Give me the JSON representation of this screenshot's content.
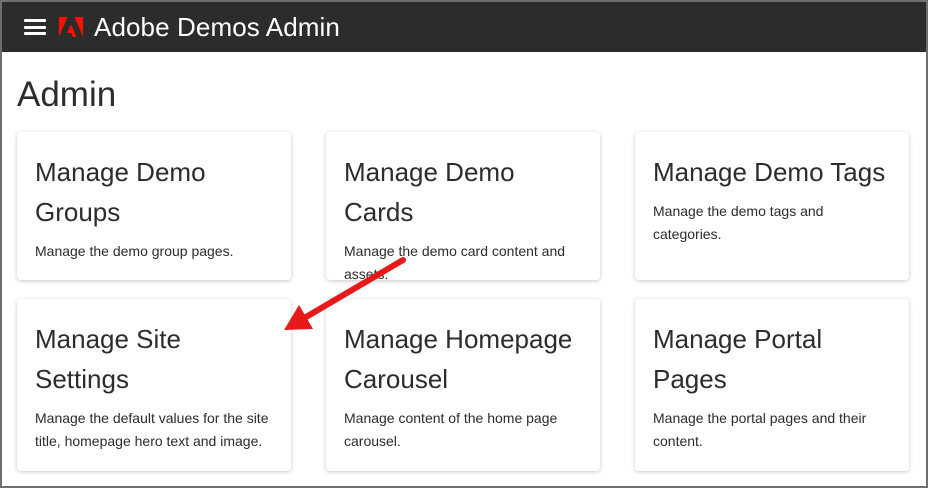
{
  "header": {
    "app_title": "Adobe Demos Admin",
    "bg_color": "#2c2c2c",
    "logo_color": "#fa0f00"
  },
  "page": {
    "title": "Admin"
  },
  "cards": [
    {
      "title": "Manage Demo Groups",
      "description": "Manage the demo group pages."
    },
    {
      "title": "Manage Demo Cards",
      "description": "Manage the demo card content and assets."
    },
    {
      "title": "Manage Demo Tags",
      "description": "Manage the demo tags and categories."
    },
    {
      "title": "Manage Site Settings",
      "description": "Manage the default values for the site title, homepage hero text and image."
    },
    {
      "title": "Manage Homepage Carousel",
      "description": "Manage content of the home page carousel."
    },
    {
      "title": "Manage Portal Pages",
      "description": "Manage the portal pages and their content."
    }
  ],
  "annotation": {
    "arrow_color": "#e8191a",
    "points_to": "Manage Site Settings"
  }
}
